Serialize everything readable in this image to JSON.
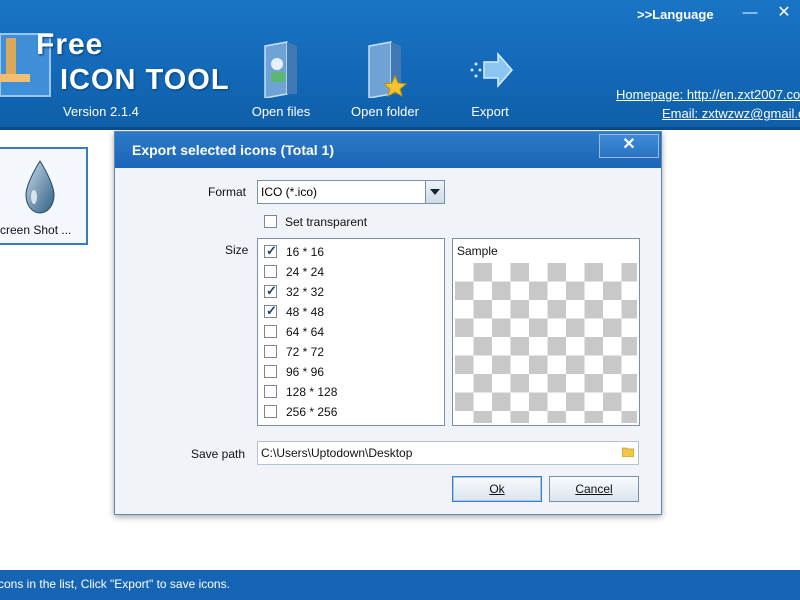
{
  "header": {
    "language": ">>Language",
    "logo_free": "Free",
    "logo_tool": "ICON TOOL",
    "version": "Version 2.1.4",
    "toolbar": {
      "open_files": "Open files",
      "open_folder": "Open folder",
      "export": "Export"
    },
    "homepage": "Homepage: http://en.zxt2007.co",
    "email": "Email: zxtwzwz@gmail.co"
  },
  "window_buttons": {
    "minimize": "—",
    "close": "✕"
  },
  "icon_list": [
    {
      "label": "creen Shot ..."
    }
  ],
  "status": "cons in the list, Click \"Export\" to save icons.",
  "dialog": {
    "title": "Export selected icons (Total 1)",
    "close": "✕",
    "format_label": "Format",
    "format_value": "ICO (*.ico)",
    "set_transparent": "Set transparent",
    "set_transparent_checked": false,
    "size_label": "Size",
    "sizes": [
      {
        "label": "16 * 16",
        "checked": true
      },
      {
        "label": "24 * 24",
        "checked": false
      },
      {
        "label": "32 * 32",
        "checked": true
      },
      {
        "label": "48 * 48",
        "checked": true
      },
      {
        "label": "64 * 64",
        "checked": false
      },
      {
        "label": "72 * 72",
        "checked": false
      },
      {
        "label": "96 * 96",
        "checked": false
      },
      {
        "label": "128 * 128",
        "checked": false
      },
      {
        "label": "256 * 256",
        "checked": false
      }
    ],
    "sample_label": "Sample",
    "save_path_label": "Save path",
    "save_path": "C:\\Users\\Uptodown\\Desktop",
    "ok": "Ok",
    "cancel": "Cancel"
  }
}
